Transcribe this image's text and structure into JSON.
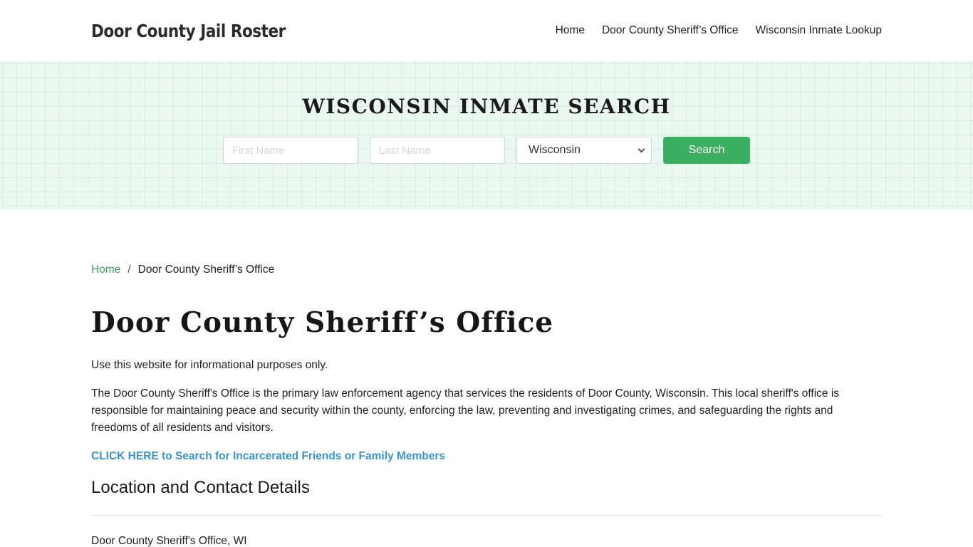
{
  "header": {
    "brand": "Door County Jail Roster",
    "nav": [
      {
        "label": "Home"
      },
      {
        "label": "Door County Sheriff’s Office"
      },
      {
        "label": "Wisconsin Inmate Lookup"
      }
    ]
  },
  "hero": {
    "title": "WISCONSIN INMATE SEARCH",
    "first_name_placeholder": "First Name",
    "first_name_value": "",
    "last_name_placeholder": "Last Name",
    "last_name_value": "",
    "state_selected": "Wisconsin",
    "search_label": "Search"
  },
  "breadcrumb": {
    "home": "Home",
    "separator": "/",
    "current": "Door County Sheriff’s Office"
  },
  "main": {
    "title": "Door County Sheriff’s Office",
    "intro": "Use this website for informational purposes only.",
    "description": "The Door County Sheriff's Office is the primary law enforcement agency that services the residents of Door County, Wisconsin. This local sheriff's office is responsible for maintaining peace and security within the county, enforcing the law, preventing and investigating crimes, and safeguarding the rights and freedoms of all residents and visitors.",
    "cta": "CLICK HERE to Search for Incarcerated Friends or Family Members",
    "section_title": "Location and Contact Details",
    "address_line": "Door County Sheriff's Office, WI"
  },
  "colors": {
    "accent_green": "#3aaf60",
    "breadcrumb_link": "#3c9d5d",
    "cta_link": "#3a94d0",
    "hero_bg": "#eaf8f1"
  }
}
